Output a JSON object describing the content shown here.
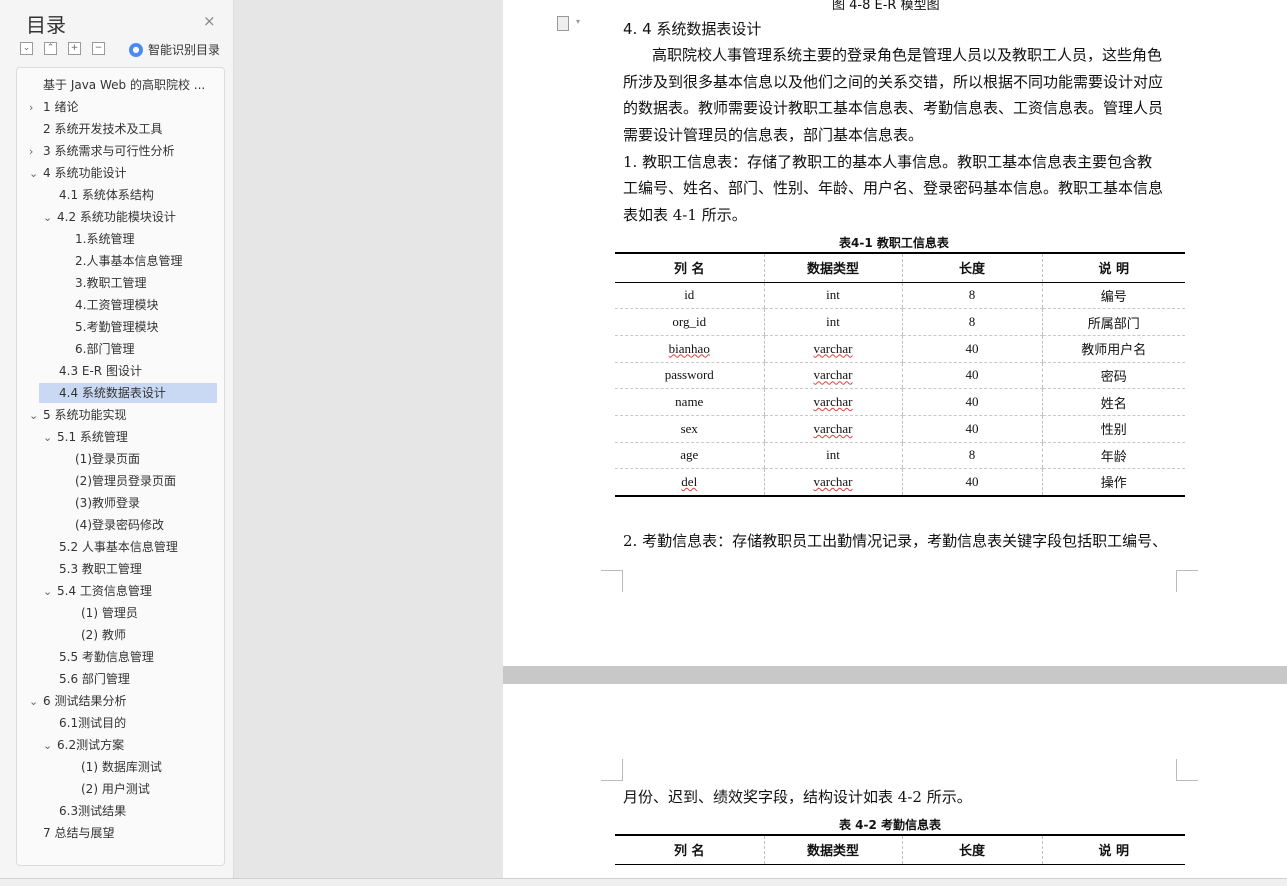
{
  "sidebar": {
    "title": "目录",
    "close_glyph": "×",
    "toolbar": {
      "expand_all": "⌄",
      "collapse_all": "⌃",
      "add": "+",
      "remove": "−"
    },
    "smart_label": "智能识别目录",
    "toc": [
      {
        "label": "基于 Java Web 的高职院校 ..."
      },
      {
        "label": "1  绪论",
        "arrow": "›"
      },
      {
        "label": "2  系统开发技术及工具"
      },
      {
        "label": "3  系统需求与可行性分析",
        "arrow": "›"
      },
      {
        "label": "4  系统功能设计",
        "arrow": "⌄"
      },
      {
        "label": "4.1  系统体系结构"
      },
      {
        "label": "4.2  系统功能模块设计",
        "arrow": "⌄"
      },
      {
        "label": "1.系统管理"
      },
      {
        "label": "2.人事基本信息管理"
      },
      {
        "label": "3.教职工管理"
      },
      {
        "label": "4.工资管理模块"
      },
      {
        "label": "5.考勤管理模块"
      },
      {
        "label": "6.部门管理"
      },
      {
        "label": "4.3 E-R 图设计"
      },
      {
        "label": "4.4  系统数据表设计",
        "active": true
      },
      {
        "label": "5  系统功能实现",
        "arrow": "⌄"
      },
      {
        "label": "5.1 系统管理",
        "arrow": "⌄"
      },
      {
        "label": "(1)登录页面"
      },
      {
        "label": "(2)管理员登录页面"
      },
      {
        "label": "(3)教师登录"
      },
      {
        "label": "(4)登录密码修改"
      },
      {
        "label": "5.2 人事基本信息管理"
      },
      {
        "label": "5.3 教职工管理"
      },
      {
        "label": "5.4 工资信息管理",
        "arrow": "⌄"
      },
      {
        "label": "(1)  管理员"
      },
      {
        "label": "(2)  教师"
      },
      {
        "label": "5.5 考勤信息管理"
      },
      {
        "label": "5.6 部门管理"
      },
      {
        "label": "6  测试结果分析",
        "arrow": "⌄"
      },
      {
        "label": "6.1测试目的"
      },
      {
        "label": "6.2测试方案",
        "arrow": "⌄"
      },
      {
        "label": "(1)  数据库测试"
      },
      {
        "label": "(2)  用户测试"
      },
      {
        "label": "6.3测试结果"
      },
      {
        "label": "7  总结与展望"
      }
    ]
  },
  "doc": {
    "top_caption": "图 4-8 E-R 模型图",
    "section_heading": "4. 4  系统数据表设计",
    "para1": [
      "高职院校人事管理系统主要的登录角色是管理人员以及教职工人员，这些角色",
      "所涉及到很多基本信息以及他们之间的关系交错，所以根据不同功能需要设计对应",
      "的数据表。教师需要设计教职工基本信息表、考勤信息表、工资信息表。管理人员",
      "需要设计管理员的信息表，部门基本信息表。"
    ],
    "para2": [
      "1. 教职工信息表：存储了教职工的基本人事信息。教职工基本信息表主要包含教",
      "工编号、姓名、部门、性别、年龄、用户名、登录密码基本信息。教职工基本信息",
      "表如表 4-1 所示。"
    ],
    "table1": {
      "caption": "表4-1  教职工信息表",
      "headers": [
        "列    名",
        "数据类型",
        "长度",
        "说    明"
      ],
      "rows": [
        [
          "id",
          "int",
          "8",
          "编号"
        ],
        [
          "org_id",
          "int",
          "8",
          "所属部门"
        ],
        [
          "bianhao",
          "varchar",
          "40",
          "教师用户名"
        ],
        [
          "password",
          "varchar",
          "40",
          "密码"
        ],
        [
          "name",
          "varchar",
          "40",
          "姓名"
        ],
        [
          "sex",
          "varchar",
          "40",
          "性别"
        ],
        [
          "age",
          "int",
          "8",
          "年龄"
        ],
        [
          "del",
          "varchar",
          "40",
          "操作"
        ]
      ]
    },
    "para3": "2. 考勤信息表：存储教职员工出勤情况记录，考勤信息表关键字段包括职工编号、",
    "page2_para": "月份、迟到、绩效奖字段，结构设计如表 4-2 所示。",
    "table2": {
      "caption": "表 4-2  考勤信息表",
      "headers": [
        "列    名",
        "数据类型",
        "长度",
        "说    明"
      ]
    }
  }
}
